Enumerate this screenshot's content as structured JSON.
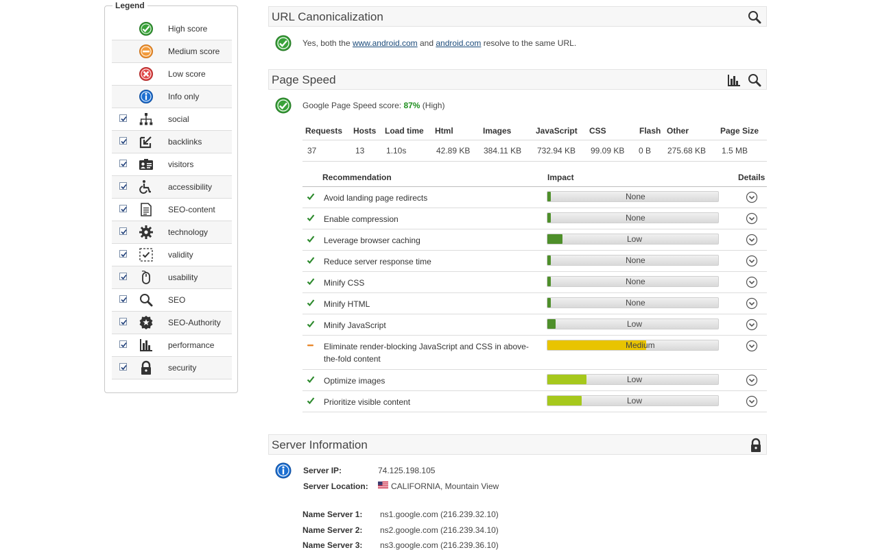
{
  "legend": {
    "title": "Legend",
    "items": [
      {
        "label": "High score",
        "icon": "check-circle-icon",
        "checkbox": false
      },
      {
        "label": "Medium score",
        "icon": "minus-circle-icon",
        "checkbox": false
      },
      {
        "label": "Low score",
        "icon": "x-circle-icon",
        "checkbox": false
      },
      {
        "label": "Info only",
        "icon": "info-circle-icon",
        "checkbox": false
      },
      {
        "label": "social",
        "icon": "sitemap-icon",
        "checkbox": true
      },
      {
        "label": "backlinks",
        "icon": "backlink-icon",
        "checkbox": true
      },
      {
        "label": "visitors",
        "icon": "visitors-icon",
        "checkbox": true
      },
      {
        "label": "accessibility",
        "icon": "wheelchair-icon",
        "checkbox": true
      },
      {
        "label": "SEO-content",
        "icon": "document-icon",
        "checkbox": true
      },
      {
        "label": "technology",
        "icon": "gear-icon",
        "checkbox": true
      },
      {
        "label": "validity",
        "icon": "validity-icon",
        "checkbox": true
      },
      {
        "label": "usability",
        "icon": "mouse-icon",
        "checkbox": true
      },
      {
        "label": "SEO",
        "icon": "magnifier-icon",
        "checkbox": true
      },
      {
        "label": "SEO-Authority",
        "icon": "badge-icon",
        "checkbox": true
      },
      {
        "label": "performance",
        "icon": "bar-chart-icon",
        "checkbox": true
      },
      {
        "label": "security",
        "icon": "lock-icon",
        "checkbox": true
      }
    ]
  },
  "url_canon": {
    "title": "URL Canonicalization",
    "text_pre": "Yes, both the ",
    "link1": "www.android.com",
    "text_mid": " and ",
    "link2": "android.com",
    "text_post": " resolve to the same URL."
  },
  "page_speed": {
    "title": "Page Speed",
    "score_pre": "Google Page Speed score: ",
    "score": "87%",
    "score_post": " (High)",
    "stats_headers": [
      "Requests",
      "Hosts",
      "Load time",
      "Html",
      "Images",
      "JavaScript",
      "CSS",
      "Flash",
      "Other",
      "Page Size"
    ],
    "stats_values": [
      "37",
      "13",
      "1.10s",
      "42.89 KB",
      "384.11 KB",
      "732.94 KB",
      "99.09 KB",
      "0 B",
      "275.68 KB",
      "1.5 MB"
    ],
    "rec_headers": {
      "recommendation": "Recommendation",
      "impact": "Impact",
      "details": "Details"
    },
    "recommendations": [
      {
        "name": "Avoid landing page redirects",
        "impact": "None",
        "level": 0.02,
        "status": "pass"
      },
      {
        "name": "Enable compression",
        "impact": "None",
        "level": 0.02,
        "status": "pass"
      },
      {
        "name": "Leverage browser caching",
        "impact": "Low",
        "level": 0.09,
        "status": "pass"
      },
      {
        "name": "Reduce server response time",
        "impact": "None",
        "level": 0.02,
        "status": "pass"
      },
      {
        "name": "Minify CSS",
        "impact": "None",
        "level": 0.02,
        "status": "pass"
      },
      {
        "name": "Minify HTML",
        "impact": "None",
        "level": 0.02,
        "status": "pass"
      },
      {
        "name": "Minify JavaScript",
        "impact": "Low",
        "level": 0.05,
        "status": "pass"
      },
      {
        "name": "Eliminate render-blocking JavaScript and CSS in above-the-fold content",
        "impact": "Medium",
        "level": 0.58,
        "status": "warn"
      },
      {
        "name": "Optimize images",
        "impact": "Low",
        "level": 0.23,
        "status": "pass"
      },
      {
        "name": "Prioritize visible content",
        "impact": "Low",
        "level": 0.2,
        "status": "pass"
      }
    ]
  },
  "server": {
    "title": "Server Information",
    "ip_label": "Server IP:",
    "ip": "74.125.198.105",
    "loc_label": "Server Location:",
    "location": "CALIFORNIA, Mountain View",
    "ns1_label": "Name Server 1:",
    "ns1": "ns1.google.com (216.239.32.10)",
    "ns2_label": "Name Server 2:",
    "ns2": "ns2.google.com (216.239.34.10)",
    "ns3_label": "Name Server 3:",
    "ns3": "ns3.google.com (216.239.36.10)"
  },
  "colors": {
    "bar_low_dark": "#4e8f2a",
    "bar_low_light": "#a6c81c",
    "bar_medium": "#e8c400",
    "score_green": "#1f8f1f"
  }
}
